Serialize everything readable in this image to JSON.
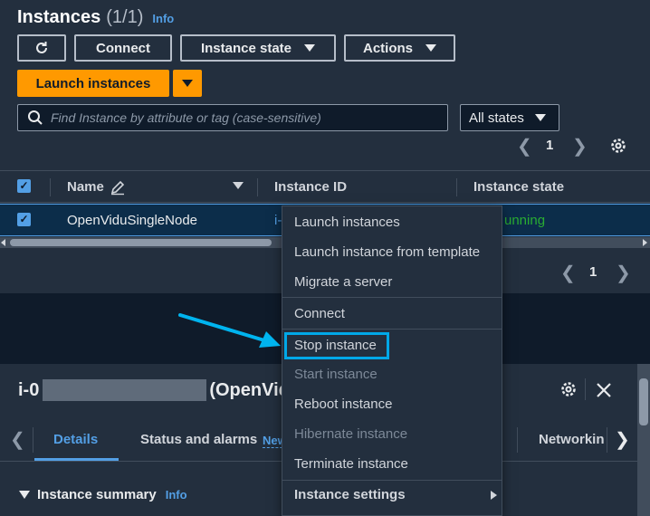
{
  "header": {
    "title": "Instances",
    "count": "(1/1)",
    "info": "Info"
  },
  "toolbar": {
    "refresh_icon": "refresh-icon",
    "connect": "Connect",
    "instance_state": "Instance state",
    "actions": "Actions",
    "launch": "Launch instances"
  },
  "search": {
    "placeholder": "Find Instance by attribute or tag (case-sensitive)"
  },
  "state_filter": {
    "selected": "All states"
  },
  "pagination": {
    "page": "1"
  },
  "table": {
    "columns": [
      "Name",
      "Instance ID",
      "Instance state"
    ],
    "rows": [
      {
        "name": "OpenViduSingleNode",
        "instance_id": "i-",
        "state": "unning"
      }
    ]
  },
  "bottom_pagination": {
    "page": "1"
  },
  "details": {
    "title_prefix": "i-0",
    "title_suffix": "(OpenVid",
    "tabs": [
      "Details",
      "Status and alarms",
      "New",
      "Networkin"
    ],
    "summary": "Instance summary",
    "summary_info": "Info"
  },
  "menu": {
    "items": [
      "Launch instances",
      "Launch instance from template",
      "Migrate a server",
      "Connect",
      "Stop instance",
      "Start instance",
      "Reboot instance",
      "Hibernate instance",
      "Terminate instance",
      "Instance settings"
    ]
  },
  "colors": {
    "accent": "#ff9900",
    "link": "#539fe5",
    "highlight": "#00a8e8",
    "running": "#29ad32"
  }
}
